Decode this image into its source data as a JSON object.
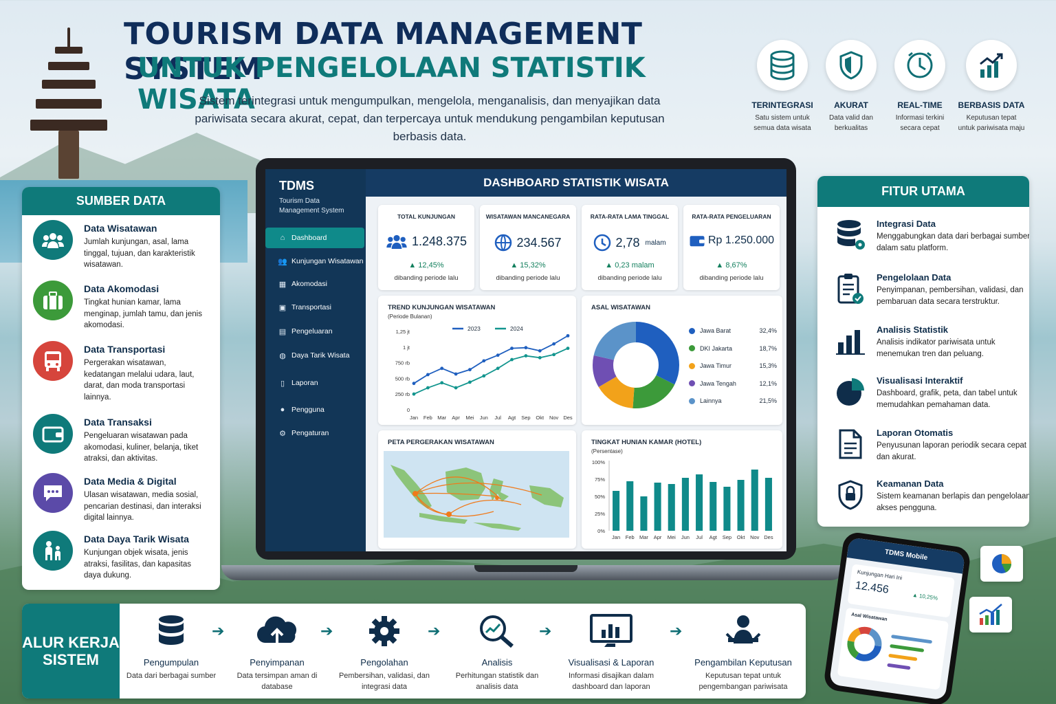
{
  "title": {
    "line1": "TOURISM DATA MANAGEMENT SYSTEM",
    "line2": "UNTUK PENGELOLAAN STATISTIK WISATA",
    "subtitle": "Sistem terintegrasi untuk mengumpulkan, mengelola, menganalisis, dan menyajikan data pariwisata secara akurat, cepat, dan terpercaya untuk mendukung pengambilan keputusan berbasis data."
  },
  "features": [
    {
      "icon": "database-icon",
      "title": "TERINTEGRASI",
      "desc": "Satu sistem untuk semua data wisata"
    },
    {
      "icon": "shield-icon",
      "title": "AKURAT",
      "desc": "Data valid dan berkualitas"
    },
    {
      "icon": "clock-icon",
      "title": "REAL-TIME",
      "desc": "Informasi terkini secara cepat"
    },
    {
      "icon": "chart-growth-icon",
      "title": "BERBASIS DATA",
      "desc": "Keputusan tepat untuk pariwisata maju"
    }
  ],
  "sources": {
    "heading": "SUMBER DATA",
    "items": [
      {
        "icon": "users-icon",
        "color": "#0f7a7a",
        "title": "Data Wisatawan",
        "desc": "Jumlah kunjungan, asal, lama tinggal, tujuan, dan karakteristik wisatawan."
      },
      {
        "icon": "suitcase-icon",
        "color": "#3c9a3a",
        "title": "Data Akomodasi",
        "desc": "Tingkat hunian kamar, lama menginap, jumlah tamu, dan jenis akomodasi."
      },
      {
        "icon": "bus-icon",
        "color": "#d6453c",
        "title": "Data Transportasi",
        "desc": "Pergerakan wisatawan, kedatangan melalui udara, laut, darat, dan moda transportasi lainnya."
      },
      {
        "icon": "wallet-icon",
        "color": "#0f7a7a",
        "title": "Data Transaksi",
        "desc": "Pengeluaran wisatawan pada akomodasi, kuliner, belanja, tiket atraksi, dan aktivitas."
      },
      {
        "icon": "chat-icon",
        "color": "#5b4aa8",
        "title": "Data Media & Digital",
        "desc": "Ulasan wisatawan, media sosial, pencarian destinasi, dan interaksi digital lainnya."
      },
      {
        "icon": "family-icon",
        "color": "#0f7a7a",
        "title": "Data Daya Tarik Wisata",
        "desc": "Kunjungan objek wisata, jenis atraksi, fasilitas, dan kapasitas daya dukung."
      }
    ]
  },
  "main_features": {
    "heading": "FITUR UTAMA",
    "items": [
      {
        "icon": "database-gear-icon",
        "title": "Integrasi Data",
        "desc": "Menggabungkan data dari berbagai sumber dalam satu platform."
      },
      {
        "icon": "clipboard-icon",
        "title": "Pengelolaan Data",
        "desc": "Penyimpanan, pembersihan, validasi, dan pembaruan data secara terstruktur."
      },
      {
        "icon": "bar-chart-icon",
        "title": "Analisis Statistik",
        "desc": "Analisis indikator pariwisata untuk menemukan tren dan peluang."
      },
      {
        "icon": "pie-chart-icon",
        "title": "Visualisasi Interaktif",
        "desc": "Dashboard, grafik, peta, dan tabel untuk memudahkan pemahaman data."
      },
      {
        "icon": "document-icon",
        "title": "Laporan Otomatis",
        "desc": "Penyusunan laporan periodik secara cepat dan akurat."
      },
      {
        "icon": "lock-shield-icon",
        "title": "Keamanan Data",
        "desc": "Sistem keamanan berlapis dan pengelolaan akses pengguna."
      }
    ]
  },
  "dashboard": {
    "brand": "TDMS",
    "brand_sub": "Tourism Data Management System",
    "header": "DASHBOARD STATISTIK WISATA",
    "menu": [
      {
        "icon": "home-icon",
        "label": "Dashboard",
        "active": true
      },
      {
        "icon": "users-icon",
        "label": "Kunjungan Wisatawan"
      },
      {
        "icon": "building-icon",
        "label": "Akomodasi"
      },
      {
        "icon": "bus-icon",
        "label": "Transportasi"
      },
      {
        "icon": "wallet-icon",
        "label": "Pengeluaran"
      },
      {
        "icon": "globe-icon",
        "label": "Daya Tarik Wisata"
      },
      {
        "icon": "document-icon",
        "label": "Laporan"
      },
      {
        "icon": "user-icon",
        "label": "Pengguna"
      },
      {
        "icon": "gear-icon",
        "label": "Pengaturan"
      }
    ],
    "kpis": [
      {
        "title": "TOTAL KUNJUNGAN",
        "icon": "users-icon",
        "value": "1.248.375",
        "unit": "",
        "change": "▲ 12,45%",
        "note": "dibanding periode lalu"
      },
      {
        "title": "WISATAWAN MANCANEGARA",
        "icon": "globe-icon",
        "value": "234.567",
        "unit": "",
        "change": "▲ 15,32%",
        "note": "dibanding periode lalu"
      },
      {
        "title": "RATA-RATA LAMA TINGGAL",
        "icon": "clock-icon",
        "value": "2,78",
        "unit": "malam",
        "change": "▲ 0,23 malam",
        "note": "dibanding periode lalu"
      },
      {
        "title": "RATA-RATA PENGELUARAN",
        "icon": "wallet-icon",
        "value": "Rp 1.250.000",
        "unit": "",
        "change": "▲ 8,67%",
        "note": "dibanding periode lalu"
      }
    ],
    "trend_title": "TREND KUNJUNGAN WISATAWAN",
    "trend_sub": "(Periode Bulanan)",
    "origin_title": "ASAL WISATAWAN",
    "map_title": "PETA PERGERAKAN WISATAWAN",
    "occupancy_title": "TINGKAT HUNIAN KAMAR (HOTEL)",
    "occupancy_sub": "(Persentase)"
  },
  "chart_data": [
    {
      "type": "line",
      "title": "TREND KUNJUNGAN WISATAWAN",
      "subtitle": "(Periode Bulanan)",
      "categories": [
        "Jan",
        "Feb",
        "Mar",
        "Apr",
        "Mei",
        "Jun",
        "Jul",
        "Agt",
        "Sep",
        "Okt",
        "Nov",
        "Des"
      ],
      "yticks": [
        "0",
        "250 rb",
        "500 rb",
        "750 rb",
        "1 jt",
        "1,25 jt"
      ],
      "ylim": [
        0,
        1250000
      ],
      "series": [
        {
          "name": "2023",
          "color": "#1f5fbf",
          "values": [
            420000,
            560000,
            660000,
            570000,
            640000,
            780000,
            870000,
            980000,
            990000,
            940000,
            1050000,
            1180000
          ]
        },
        {
          "name": "2024",
          "color": "#12958e",
          "values": [
            250000,
            350000,
            430000,
            350000,
            440000,
            540000,
            660000,
            800000,
            860000,
            830000,
            880000,
            980000
          ]
        }
      ]
    },
    {
      "type": "pie",
      "title": "ASAL WISATAWAN",
      "slices": [
        {
          "label": "Jawa Barat",
          "value": 32.4,
          "display": "32,4%",
          "color": "#1f5fbf"
        },
        {
          "label": "DKI Jakarta",
          "value": 18.7,
          "display": "18,7%",
          "color": "#3c9a3a"
        },
        {
          "label": "Jawa Timur",
          "value": 15.3,
          "display": "15,3%",
          "color": "#f2a21a"
        },
        {
          "label": "Jawa Tengah",
          "value": 12.1,
          "display": "12,1%",
          "color": "#6f4fb3"
        },
        {
          "label": "Lainnya",
          "value": 21.5,
          "display": "21,5%",
          "color": "#5b93c9"
        }
      ]
    },
    {
      "type": "bar",
      "title": "TINGKAT HUNIAN KAMAR (HOTEL)",
      "subtitle": "(Persentase)",
      "categories": [
        "Jan",
        "Feb",
        "Mar",
        "Apr",
        "Mei",
        "Jun",
        "Jul",
        "Agt",
        "Sep",
        "Okt",
        "Nov",
        "Des"
      ],
      "yticks": [
        "0%",
        "25%",
        "50%",
        "75%",
        "100%"
      ],
      "ylim": [
        0,
        100
      ],
      "values": [
        58,
        72,
        50,
        70,
        68,
        77,
        82,
        71,
        64,
        74,
        89,
        77
      ],
      "color": "#0f8a8a"
    }
  ],
  "workflow": {
    "heading": "ALUR KERJA SISTEM",
    "steps": [
      {
        "icon": "database-icon",
        "title": "Pengumpulan",
        "desc": "Data dari berbagai sumber"
      },
      {
        "icon": "cloud-upload-icon",
        "title": "Penyimpanan",
        "desc": "Data tersimpan aman di database"
      },
      {
        "icon": "gear-icon",
        "title": "Pengolahan",
        "desc": "Pembersihan, validasi, dan integrasi data"
      },
      {
        "icon": "magnifier-chart-icon",
        "title": "Analisis",
        "desc": "Perhitungan statistik dan analisis data"
      },
      {
        "icon": "monitor-chart-icon",
        "title": "Visualisasi & Laporan",
        "desc": "Informasi disajikan dalam dashboard dan laporan"
      },
      {
        "icon": "presenter-icon",
        "title": "Pengambilan Keputusan",
        "desc": "Keputusan tepat untuk pengembangan pariwisata"
      }
    ]
  },
  "mobile": {
    "app_title": "TDMS Mobile",
    "kpi_label": "Kunjungan Hari Ini",
    "kpi_value": "12.456",
    "kpi_change": "▲ 10,25%",
    "chart_label": "Asal Wisatawan"
  }
}
